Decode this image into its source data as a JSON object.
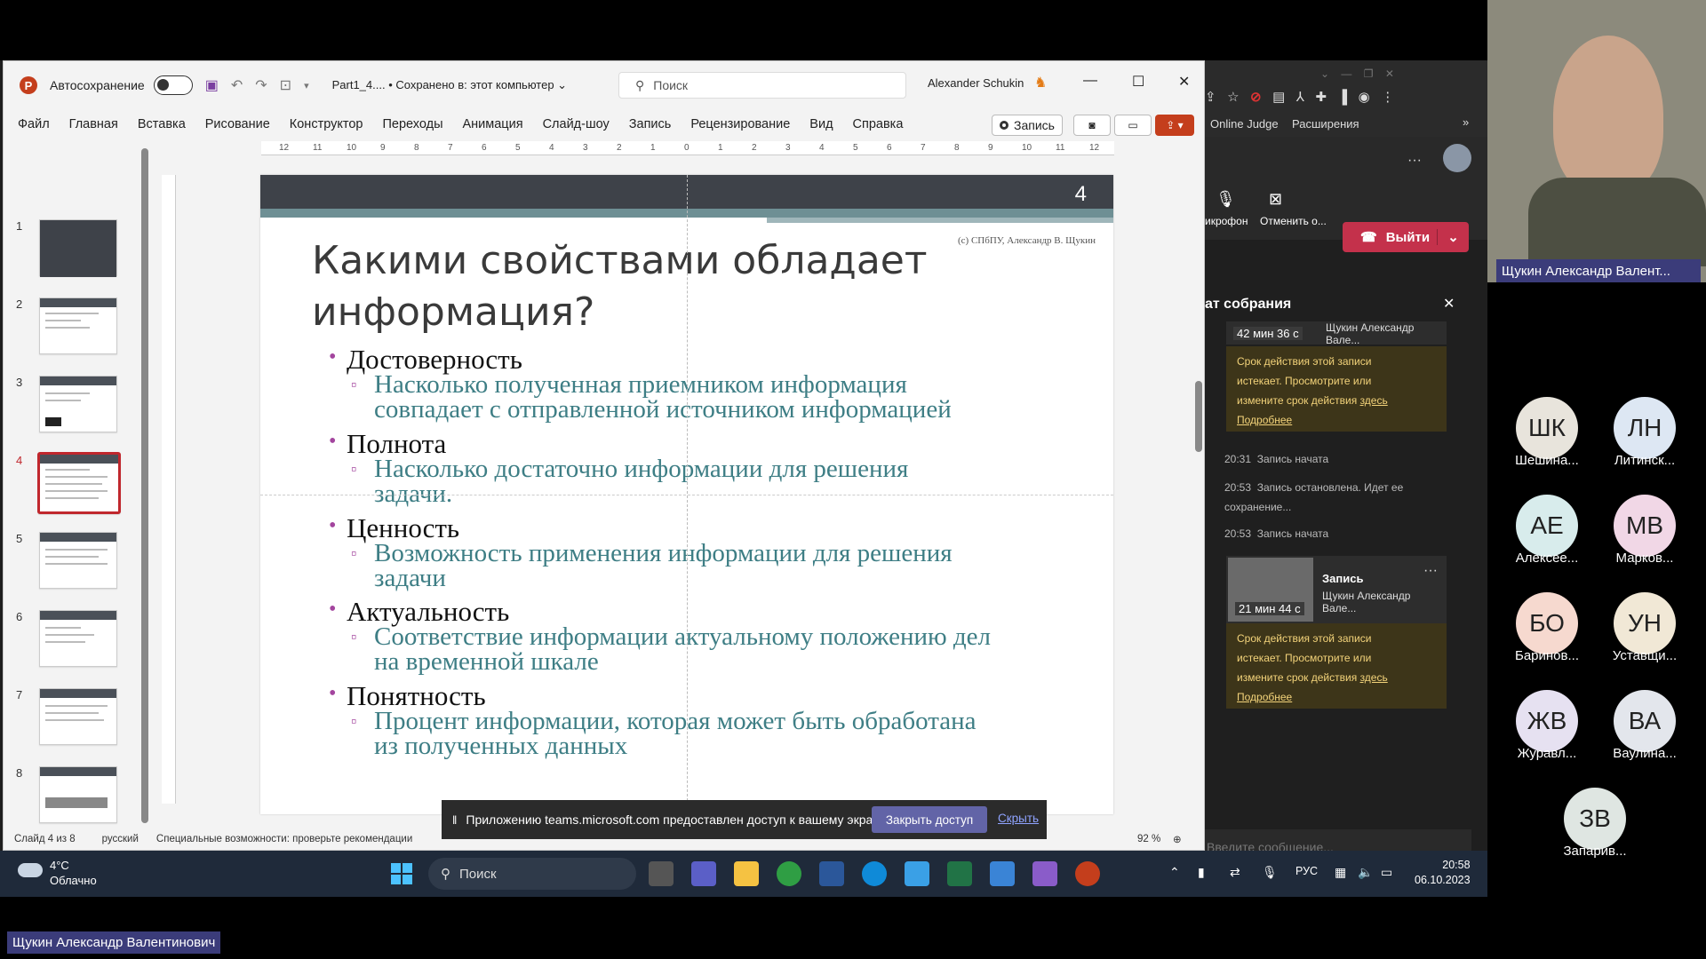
{
  "ppt": {
    "autosave_label": "Автосохранение",
    "doc_title": "Part1_4.... • Сохранено в: этот компьютер ⌄",
    "search_placeholder": "Поиск",
    "user_name": "Alexander Schukin",
    "menu": [
      "Файл",
      "Главная",
      "Вставка",
      "Рисование",
      "Конструктор",
      "Переходы",
      "Анимация",
      "Слайд-шоу",
      "Запись",
      "Рецензирование",
      "Вид",
      "Справка"
    ],
    "record_label": "Запись",
    "ruler_labels": [
      "12",
      "11",
      "10",
      "9",
      "8",
      "7",
      "6",
      "5",
      "4",
      "3",
      "2",
      "1",
      "0",
      "1",
      "2",
      "3",
      "4",
      "5",
      "6",
      "7",
      "8",
      "9",
      "10",
      "11",
      "12"
    ],
    "thumb_numbers": [
      "1",
      "2",
      "3",
      "4",
      "5",
      "6",
      "7",
      "8"
    ],
    "slide": {
      "page_number": "4",
      "copyright": "(с) СПбПУ, Александр В. Щукин",
      "title_line1": "Какими свойствами обладает",
      "title_line2": "информация?",
      "items": [
        {
          "head": "Достоверность",
          "sub1": "Насколько полученная приемником информация",
          "sub2": "совпадает с отправленной источником информацией"
        },
        {
          "head": "Полнота",
          "sub1": "Насколько достаточно информации для решения",
          "sub2": "задачи."
        },
        {
          "head": "Ценность",
          "sub1": "Возможность применения информации для решения",
          "sub2": "задачи"
        },
        {
          "head": "Актуальность",
          "sub1": "Соответствие информации актуальному положению дел",
          "sub2": "на временной шкале"
        },
        {
          "head": "Понятность",
          "sub1": "Процент информации, которая может быть обработана",
          "sub2": "из полученных данных"
        }
      ]
    },
    "status": {
      "slide_of": "Слайд 4 из 8",
      "language": "русский",
      "accessibility": "Специальные возможности: проверьте рекомендации",
      "zoom": "92 %"
    }
  },
  "banner": {
    "text": "Приложению teams.microsoft.com предоставлен доступ к вашему экрану.",
    "stop_button": "Закрыть доступ",
    "hide_link": "Скрыть"
  },
  "taskbar": {
    "temp": "4°C",
    "weather": "Облачно",
    "search": "Поиск",
    "lang": "РУС",
    "time": "20:58",
    "date": "06.10.2023"
  },
  "teams": {
    "bookmarks": [
      "Online Judge",
      "Расширения"
    ],
    "mic_label": "икрофон",
    "cancel_label": "Отменить о...",
    "leave_label": "Выйти",
    "chat_title": "ат собрания",
    "rec1_duration": "42 мин 36 с",
    "rec1_author": "Щукин Александр Вале...",
    "warn_text1": "Срок действия этой записи",
    "warn_text2": "истекает. Просмотрите или",
    "warn_text3": "измените срок действия",
    "warn_link": "здесь",
    "warn_more": "Подробнее",
    "events": [
      {
        "time": "20:31",
        "text": "Запись начата"
      },
      {
        "time": "20:53",
        "text": "Запись остановлена. Идет ее"
      },
      {
        "time": "",
        "text": "сохранение..."
      },
      {
        "time": "20:53",
        "text": "Запись начата"
      }
    ],
    "rec2_title": "Запись",
    "rec2_author": "Щукин Александр Вале...",
    "rec2_duration": "21 мин 44 с",
    "message_placeholder": "Введите сообщение..."
  },
  "camera": {
    "name": "Щукин Александр Валент..."
  },
  "participants": [
    {
      "initials": "ШК",
      "name": "Шешина...",
      "color": "#e8e4dc"
    },
    {
      "initials": "ЛН",
      "name": "Литинск...",
      "color": "#dde7f3"
    },
    {
      "initials": "АЕ",
      "name": "Алексее...",
      "color": "#d8ecec"
    },
    {
      "initials": "МВ",
      "name": "Марков...",
      "color": "#f1d7e6"
    },
    {
      "initials": "БО",
      "name": "Баринов...",
      "color": "#f6d9cf"
    },
    {
      "initials": "УН",
      "name": "Уставщи...",
      "color": "#f1e8d6"
    },
    {
      "initials": "ЖВ",
      "name": "Журавл...",
      "color": "#e6e1f1"
    },
    {
      "initials": "ВА",
      "name": "Ваулина...",
      "color": "#e3e6ec"
    },
    {
      "initials": "ЗВ",
      "name": "Запарив...",
      "color": "#dfe6e2"
    }
  ],
  "presenter_name": "Щукин Александр Валентинович"
}
